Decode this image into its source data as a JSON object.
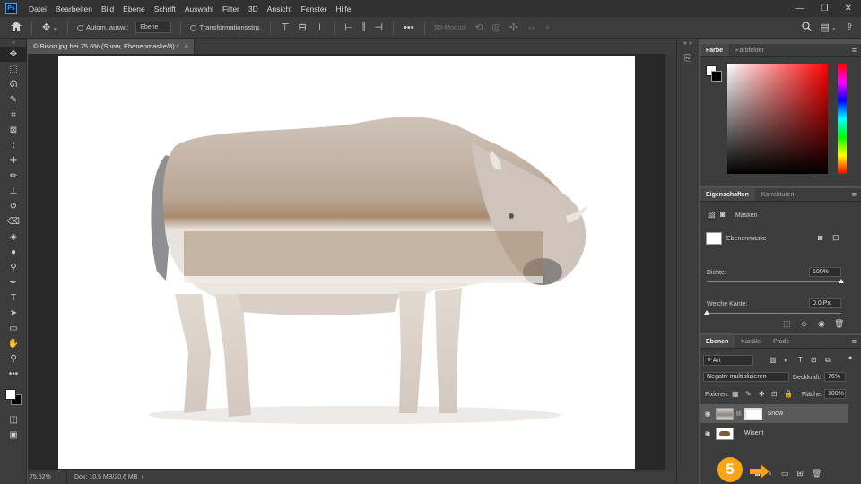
{
  "app": {
    "logo_text": "Ps"
  },
  "menubar": {
    "items": [
      "Datei",
      "Bearbeiten",
      "Bild",
      "Ebene",
      "Schrift",
      "Auswahl",
      "Filter",
      "3D",
      "Ansicht",
      "Fenster",
      "Hilfe"
    ],
    "window_buttons": [
      "—",
      "❐",
      "✕"
    ]
  },
  "options_bar": {
    "auto_select_label": "Autom. ausw.:",
    "auto_select_value": "Ebene",
    "transform_label": "Transformationsstrg.",
    "mode_label": "3D-Modus:",
    "more_icon": "•••"
  },
  "document": {
    "tab_title": "© Bison.jpg bei 75.6% (Snow, Ebenenmaske/8) *",
    "close_icon": "×"
  },
  "status": {
    "zoom": "75.62%",
    "doc_info": "Dok: 10.5 MB/20.6 MB",
    "arrow": "›"
  },
  "color_panel": {
    "tabs": [
      "Farbe",
      "Farbfelder"
    ]
  },
  "properties_panel": {
    "tabs": [
      "Eigenschaften",
      "Korrekturen"
    ],
    "section_label": "Masken",
    "mask_type": "Ebenenmaske",
    "density_label": "Dichte:",
    "density_value": "100%",
    "density_level": 1.0,
    "feather_label": "Weiche Kante:",
    "feather_value": "0.0 Px",
    "feather_level": 0.0
  },
  "layers_panel": {
    "tabs": [
      "Ebenen",
      "Kanäle",
      "Pfade"
    ],
    "filter_value": "Art",
    "blend_mode": "Negativ multiplizieren",
    "opacity_label": "Deckkraft:",
    "opacity_value": "76%",
    "lock_label": "Fixieren:",
    "fill_label": "Fläche:",
    "fill_value": "100%",
    "layers": [
      {
        "name": "Snow",
        "selected": true
      },
      {
        "name": "Wisent",
        "selected": false
      }
    ]
  },
  "annotation": {
    "step_number": "5"
  },
  "colors": {
    "accent_orange": "#f7a416",
    "ps_blue": "#31a8ff"
  }
}
